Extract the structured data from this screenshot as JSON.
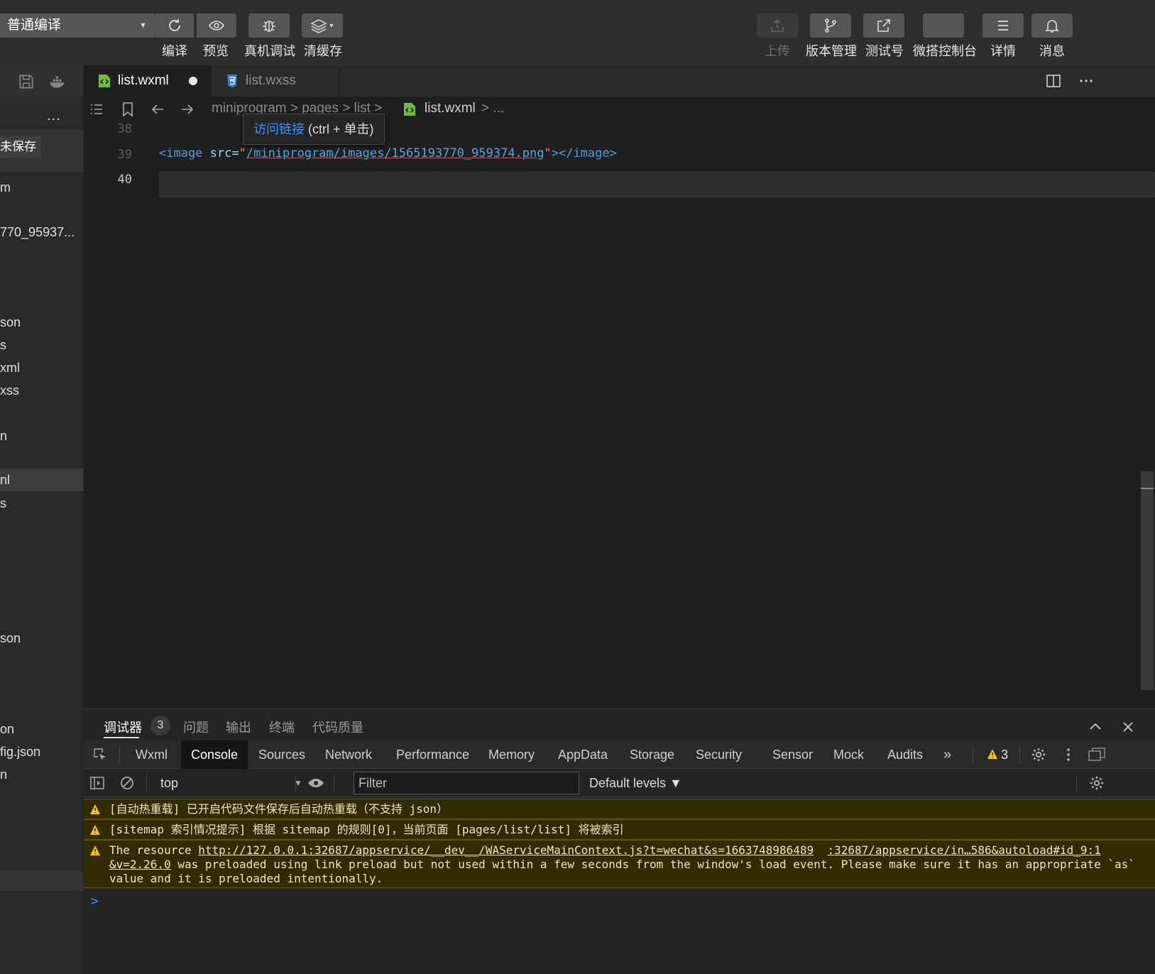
{
  "toolbar": {
    "compile_mode": "普通编译",
    "buttons": {
      "compile": "编译",
      "preview": "预览",
      "remote_debug": "真机调试",
      "clear_cache": "清缓存",
      "upload": "上传",
      "version": "版本管理",
      "test_account": "测试号",
      "weida_console": "微搭控制台",
      "details": "详情",
      "messages": "消息"
    }
  },
  "sidebar": {
    "more": "...",
    "unsaved": "未保存",
    "items": [
      "m",
      "770_95937...",
      "son",
      "s",
      "xml",
      "xss",
      "n",
      "nl",
      "s",
      "son",
      "on",
      "fig.json",
      "n"
    ]
  },
  "tabs": [
    {
      "label": "list.wxml",
      "modified": true
    },
    {
      "label": "list.wxss"
    }
  ],
  "breadcrumb": {
    "path": "miniprogram > pages > list >",
    "file": "list.wxml",
    "tail": "> ..."
  },
  "tooltip": {
    "link": "访问链接",
    "hint": " (ctrl + 单击)"
  },
  "editor": {
    "lines": [
      {
        "no": "38",
        "code": ""
      },
      {
        "no": "39",
        "tag_open": "<image ",
        "attr": "src=",
        "q1": "\"",
        "link": "/miniprogram/images/1565193770_959374.png",
        "q2": "\"",
        "tag_close": "></image>"
      },
      {
        "no": "40",
        "code": ""
      }
    ]
  },
  "panel": {
    "tabs": [
      "调试器",
      "问题",
      "输出",
      "终端",
      "代码质量"
    ],
    "badge": "3",
    "devtools_tabs": [
      "Wxml",
      "Console",
      "Sources",
      "Network",
      "Performance",
      "Memory",
      "AppData",
      "Storage",
      "Security",
      "Sensor",
      "Mock",
      "Audits"
    ],
    "overflow": "»",
    "warning_count": "3",
    "context": "top",
    "filter_placeholder": "Filter",
    "levels": "Default levels ▼",
    "messages": [
      {
        "text": "[自动热重载] 已开启代码文件保存后自动热重载（不支持 json）"
      },
      {
        "text": "[sitemap 索引情况提示] 根据 sitemap 的规则[0]，当前页面 [pages/list/list] 将被索引"
      },
      {
        "prefix": "The resource ",
        "url1": "http://127.0.0.1:32687/appservice/__dev__/WAServiceMainContext.js?t=wechat&s=1663748986489",
        "url2": ":32687/appservice/in…586&autoload#id_9:1",
        "url3": "&v=2.26.0",
        "suffix": " was preloaded using link preload but not used within a few seconds from the window's load event. Please make sure it has an appropriate `as` value and it is preloaded intentionally."
      }
    ],
    "prompt": ">"
  }
}
